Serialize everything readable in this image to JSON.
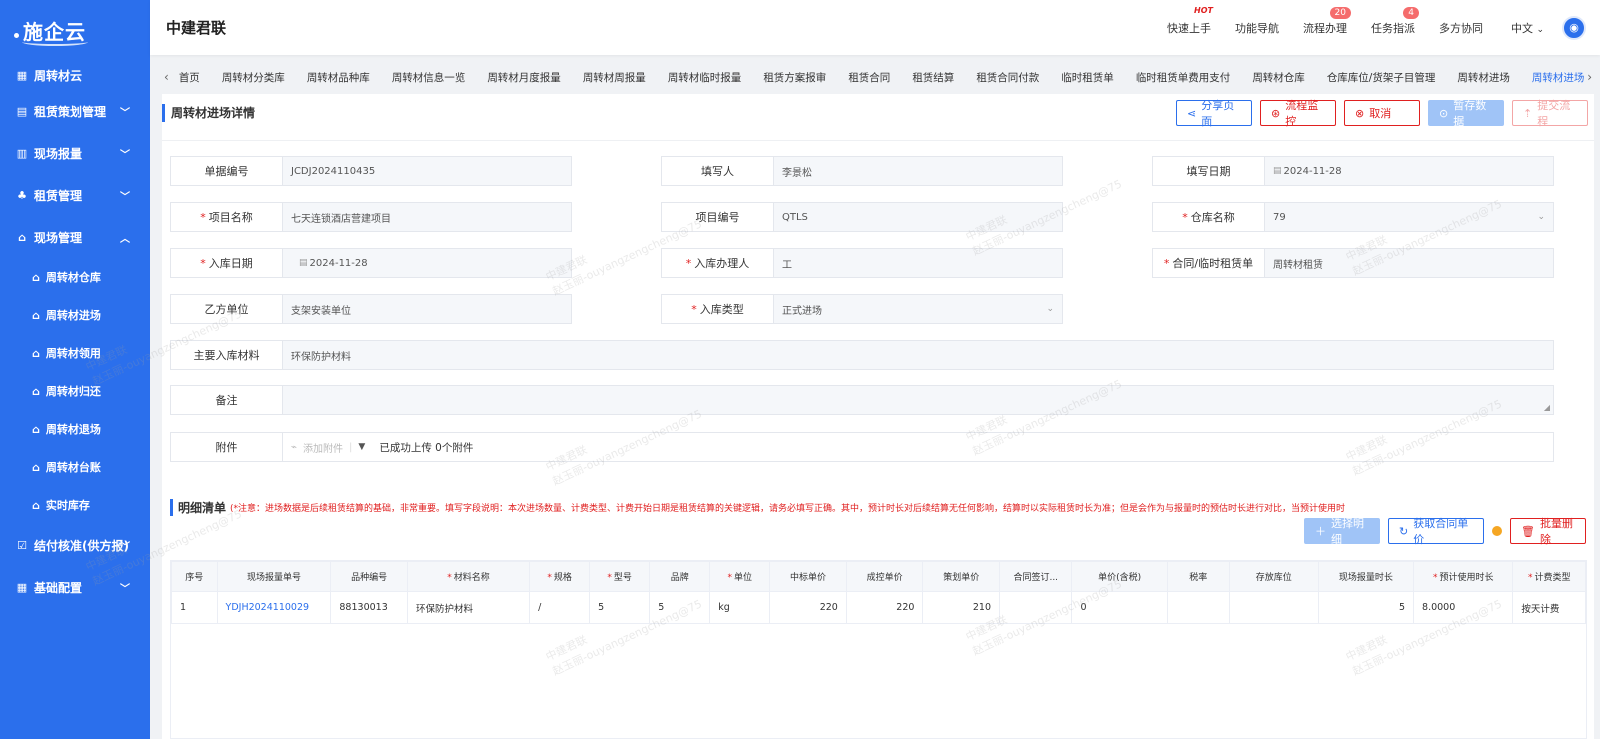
{
  "app": {
    "logo_text": "施企云",
    "company": "中建君联"
  },
  "sidebar": {
    "header_label": "周转材云",
    "items": [
      {
        "label": "租赁策划管理",
        "icon": "ledger-icon"
      },
      {
        "label": "现场报量",
        "icon": "chart-icon"
      },
      {
        "label": "租赁管理",
        "icon": "org-icon"
      },
      {
        "label": "现场管理",
        "icon": "home-icon",
        "expanded": true
      },
      {
        "label": "结付核准(供方报)",
        "icon": "checklist-icon"
      },
      {
        "label": "基础配置",
        "icon": "grid-icon"
      }
    ],
    "sub_items": [
      {
        "label": "周转材仓库"
      },
      {
        "label": "周转材进场"
      },
      {
        "label": "周转材领用"
      },
      {
        "label": "周转材归还"
      },
      {
        "label": "周转材退场"
      },
      {
        "label": "周转材台账"
      },
      {
        "label": "实时库存"
      }
    ]
  },
  "topbar": {
    "links": [
      {
        "label": "快速上手",
        "badge": "HOT"
      },
      {
        "label": "功能导航",
        "badge": ""
      },
      {
        "label": "流程办理",
        "badge": "20"
      },
      {
        "label": "任务指派",
        "badge": "4"
      },
      {
        "label": "多方协同",
        "badge": ""
      }
    ],
    "language": "中文"
  },
  "tabs": [
    "首页",
    "周转材分类库",
    "周转材品种库",
    "周转材信息一览",
    "周转材月度报量",
    "周转材周报量",
    "周转材临时报量",
    "租赁方案报审",
    "租赁合同",
    "租赁结算",
    "租赁合同付款",
    "临时租赁单",
    "临时租赁单费用支付",
    "周转材仓库",
    "仓库库位/货架子目管理",
    "周转材进场",
    "周转材进场"
  ],
  "active_tab_index": 16,
  "page": {
    "title": "周转材进场详情",
    "buttons": {
      "share": "分享页面",
      "monitor": "流程监控",
      "cancel": "取消",
      "save_draft": "暂存数据",
      "submit": "提交流程"
    }
  },
  "form": {
    "doc_no": {
      "label": "单据编号",
      "value": "JCDJ2024110435"
    },
    "filler": {
      "label": "填写人",
      "value": "李景松"
    },
    "fill_date": {
      "label": "填写日期",
      "value": "2024-11-28"
    },
    "project_name": {
      "label": "项目名称",
      "value": "七天连锁酒店营建项目"
    },
    "project_no": {
      "label": "项目编号",
      "value": "QTLS"
    },
    "warehouse": {
      "label": "仓库名称",
      "value": "79"
    },
    "in_date": {
      "label": "入库日期",
      "value": "2024-11-28"
    },
    "handler": {
      "label": "入库办理人",
      "value": "工"
    },
    "contract": {
      "label": "合同/临时租赁单",
      "value": "周转材租赁"
    },
    "party_b": {
      "label": "乙方单位",
      "value": "支架安装单位"
    },
    "in_type": {
      "label": "入库类型",
      "value": "正式进场"
    },
    "main_material": {
      "label": "主要入库材料",
      "value": "环保防护材料"
    },
    "remark": {
      "label": "备注",
      "value": ""
    },
    "attachment": {
      "label": "附件",
      "add_label": "添加附件",
      "status": "已成功上传 0个附件"
    }
  },
  "details": {
    "title": "明细清单",
    "note": "(*注意：进场数据是后续租赁结算的基础，非常重要。填写字段说明：本次进场数量、计费类型、计费开始日期是租赁结算的关键逻辑，请务必填写正确。其中，预计时长对后续结算无任何影响，结算时以实际租赁时长为准；但是会作为与报量时的预估时长进行对比，当预计使用时长超...",
    "buttons": {
      "select": "选择明细",
      "get_price": "获取合同单价",
      "batch_delete": "批量删除"
    },
    "columns": [
      {
        "label": "序号",
        "req": false
      },
      {
        "label": "现场报量单号",
        "req": false
      },
      {
        "label": "品种编号",
        "req": false
      },
      {
        "label": "材料名称",
        "req": true
      },
      {
        "label": "规格",
        "req": true
      },
      {
        "label": "型号",
        "req": true
      },
      {
        "label": "品牌",
        "req": false
      },
      {
        "label": "单位",
        "req": true
      },
      {
        "label": "中标单价",
        "req": false
      },
      {
        "label": "成控单价",
        "req": false
      },
      {
        "label": "策划单价",
        "req": false
      },
      {
        "label": "合同签订...",
        "req": false
      },
      {
        "label": "单价(含税)",
        "req": false
      },
      {
        "label": "税率",
        "req": false
      },
      {
        "label": "存放库位",
        "req": false
      },
      {
        "label": "现场报量时长",
        "req": false
      },
      {
        "label": "预计使用时长",
        "req": true
      },
      {
        "label": "计费类型",
        "req": true
      }
    ],
    "rows": [
      [
        "1",
        "YDJH2024110029",
        "88130013",
        "环保防护材料",
        "/",
        "5",
        "5",
        "kg",
        "220",
        "220",
        "210",
        "",
        "0",
        "",
        "",
        "5",
        "8.0000",
        "按天计费"
      ]
    ]
  },
  "watermark": {
    "line1": "中建君联",
    "line2": "赵玉丽-ouyangzengcheng@75"
  }
}
